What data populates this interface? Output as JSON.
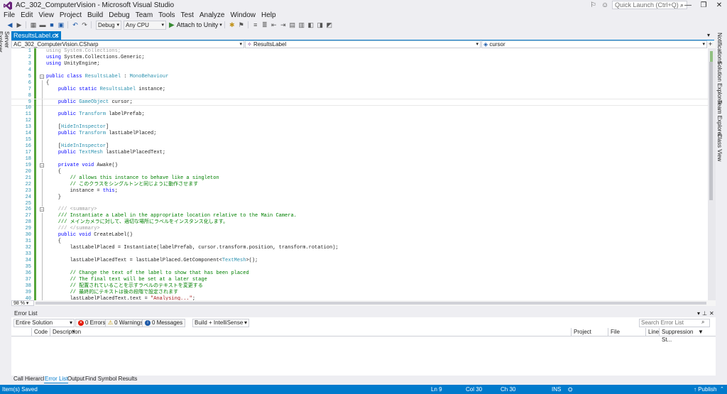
{
  "window": {
    "title": "AC_302_ComputerVision - Microsoft Visual Studio",
    "quick_launch_placeholder": "Quick Launch (Ctrl+Q)"
  },
  "menu": [
    "File",
    "Edit",
    "View",
    "Project",
    "Build",
    "Debug",
    "Team",
    "Tools",
    "Test",
    "Analyze",
    "Window",
    "Help"
  ],
  "toolbar": {
    "config": "Debug",
    "platform": "Any CPU",
    "attach_label": "Attach to Unity"
  },
  "side_tabs": {
    "left": "Server Explorer",
    "right": [
      "Notifications",
      "Solution Explorer",
      "Team Explorer",
      "Class View"
    ]
  },
  "doc_tab": {
    "label": "ResultsLabel.cs"
  },
  "nav": {
    "project": "AC_302_ComputerVision.CSharp",
    "class": "ResultsLabel",
    "member": "cursor"
  },
  "code": [
    {
      "n": 1,
      "tokens": [
        [
          "dim",
          "using System.Collections;"
        ]
      ]
    },
    {
      "n": 2,
      "tokens": [
        [
          "kw",
          "using"
        ],
        [
          "",
          " System.Collections.Generic;"
        ]
      ]
    },
    {
      "n": 3,
      "tokens": [
        [
          "kw",
          "using"
        ],
        [
          "",
          " UnityEngine;"
        ]
      ]
    },
    {
      "n": 4,
      "tokens": []
    },
    {
      "n": 5,
      "fold": true,
      "tokens": [
        [
          "kw",
          "public class"
        ],
        [
          "",
          " "
        ],
        [
          "ty",
          "ResultsLabel"
        ],
        [
          "",
          " : "
        ],
        [
          "ty",
          "MonoBehaviour"
        ]
      ]
    },
    {
      "n": 6,
      "tokens": [
        [
          "",
          "{"
        ]
      ]
    },
    {
      "n": 7,
      "tokens": [
        [
          "",
          "    "
        ],
        [
          "kw",
          "public static"
        ],
        [
          "",
          " "
        ],
        [
          "ty",
          "ResultsLabel"
        ],
        [
          "",
          " instance;"
        ]
      ]
    },
    {
      "n": 8,
      "tokens": []
    },
    {
      "n": 9,
      "cur": true,
      "tokens": [
        [
          "",
          "    "
        ],
        [
          "kw",
          "public"
        ],
        [
          "",
          " "
        ],
        [
          "ty",
          "GameObject"
        ],
        [
          "",
          " cursor;"
        ]
      ]
    },
    {
      "n": 10,
      "tokens": []
    },
    {
      "n": 11,
      "tokens": [
        [
          "",
          "    "
        ],
        [
          "kw",
          "public"
        ],
        [
          "",
          " "
        ],
        [
          "ty",
          "Transform"
        ],
        [
          "",
          " labelPrefab;"
        ]
      ]
    },
    {
      "n": 12,
      "tokens": []
    },
    {
      "n": 13,
      "tokens": [
        [
          "",
          "    ["
        ],
        [
          "ty",
          "HideInInspector"
        ],
        [
          "",
          "]"
        ]
      ]
    },
    {
      "n": 14,
      "tokens": [
        [
          "",
          "    "
        ],
        [
          "kw",
          "public"
        ],
        [
          "",
          " "
        ],
        [
          "ty",
          "Transform"
        ],
        [
          "",
          " lastLabelPlaced;"
        ]
      ]
    },
    {
      "n": 15,
      "tokens": []
    },
    {
      "n": 16,
      "tokens": [
        [
          "",
          "    ["
        ],
        [
          "ty",
          "HideInInspector"
        ],
        [
          "",
          "]"
        ]
      ]
    },
    {
      "n": 17,
      "tokens": [
        [
          "",
          "    "
        ],
        [
          "kw",
          "public"
        ],
        [
          "",
          " "
        ],
        [
          "ty",
          "TextMesh"
        ],
        [
          "",
          " lastLabelPlacedText;"
        ]
      ]
    },
    {
      "n": 18,
      "tokens": []
    },
    {
      "n": 19,
      "fold": true,
      "tokens": [
        [
          "",
          "    "
        ],
        [
          "kw",
          "private void"
        ],
        [
          "",
          " Awake()"
        ]
      ]
    },
    {
      "n": 20,
      "tokens": [
        [
          "",
          "    {"
        ]
      ]
    },
    {
      "n": 21,
      "tokens": [
        [
          "cm",
          "        // allows this instance to behave like a singleton"
        ]
      ]
    },
    {
      "n": 22,
      "tokens": [
        [
          "cm",
          "        // このクラスをシングルトンと同じように動作させます"
        ]
      ]
    },
    {
      "n": 23,
      "tokens": [
        [
          "",
          "        instance = "
        ],
        [
          "kw",
          "this"
        ],
        [
          "",
          ";"
        ]
      ]
    },
    {
      "n": 24,
      "tokens": [
        [
          "",
          "    }"
        ]
      ]
    },
    {
      "n": 25,
      "tokens": []
    },
    {
      "n": 26,
      "fold": true,
      "tokens": [
        [
          "dim",
          "    /// <summary>"
        ]
      ]
    },
    {
      "n": 27,
      "tokens": [
        [
          "cm",
          "    /// Instantiate a Label in the appropriate location relative to the Main Camera."
        ]
      ]
    },
    {
      "n": 28,
      "tokens": [
        [
          "cm",
          "    /// メインカメラに対して、適切な場所にラベルをインスタンス化します。"
        ]
      ]
    },
    {
      "n": 29,
      "tokens": [
        [
          "dim",
          "    /// </summary>"
        ]
      ]
    },
    {
      "n": 30,
      "tokens": [
        [
          "",
          "    "
        ],
        [
          "kw",
          "public void"
        ],
        [
          "",
          " CreateLabel()"
        ]
      ]
    },
    {
      "n": 31,
      "tokens": [
        [
          "",
          "    {"
        ]
      ]
    },
    {
      "n": 32,
      "tokens": [
        [
          "",
          "        lastLabelPlaced = Instantiate(labelPrefab, cursor.transform.position, transform.rotation);"
        ]
      ]
    },
    {
      "n": 33,
      "tokens": []
    },
    {
      "n": 34,
      "tokens": [
        [
          "",
          "        lastLabelPlacedText = lastLabelPlaced.GetComponent<"
        ],
        [
          "ty",
          "TextMesh"
        ],
        [
          "",
          ">();"
        ]
      ]
    },
    {
      "n": 35,
      "tokens": []
    },
    {
      "n": 36,
      "tokens": [
        [
          "cm",
          "        // Change the text of the label to show that has been placed"
        ]
      ]
    },
    {
      "n": 37,
      "tokens": [
        [
          "cm",
          "        // The final text will be set at a later stage"
        ]
      ]
    },
    {
      "n": 38,
      "tokens": [
        [
          "cm",
          "        // 配置されていることを示すラベルのテキストを変更する"
        ]
      ]
    },
    {
      "n": 39,
      "tokens": [
        [
          "cm",
          "        // 最終的にテキストは後の段階で設定されます"
        ]
      ]
    },
    {
      "n": 40,
      "tokens": [
        [
          "",
          "        lastLabelPlacedText.text = "
        ],
        [
          "st",
          "\"Analysing...\""
        ],
        [
          "",
          ";"
        ]
      ]
    }
  ],
  "zoom": "98 %",
  "error_list": {
    "title": "Error List",
    "scope": "Entire Solution",
    "errors": "0 Errors",
    "warnings": "0 Warnings",
    "messages": "0 Messages",
    "filter": "Build + IntelliSense",
    "search_placeholder": "Search Error List",
    "columns": [
      "Code",
      "Description",
      "Project",
      "File",
      "Line",
      "Suppression St..."
    ]
  },
  "bottom_tabs": [
    "Call Hierarchy",
    "Error List",
    "Output",
    "Find Symbol Results"
  ],
  "status": {
    "message": "Item(s) Saved",
    "ln": "Ln 9",
    "col": "Col 30",
    "ch": "Ch 30",
    "mode": "INS",
    "publish": "↑ Publish"
  }
}
